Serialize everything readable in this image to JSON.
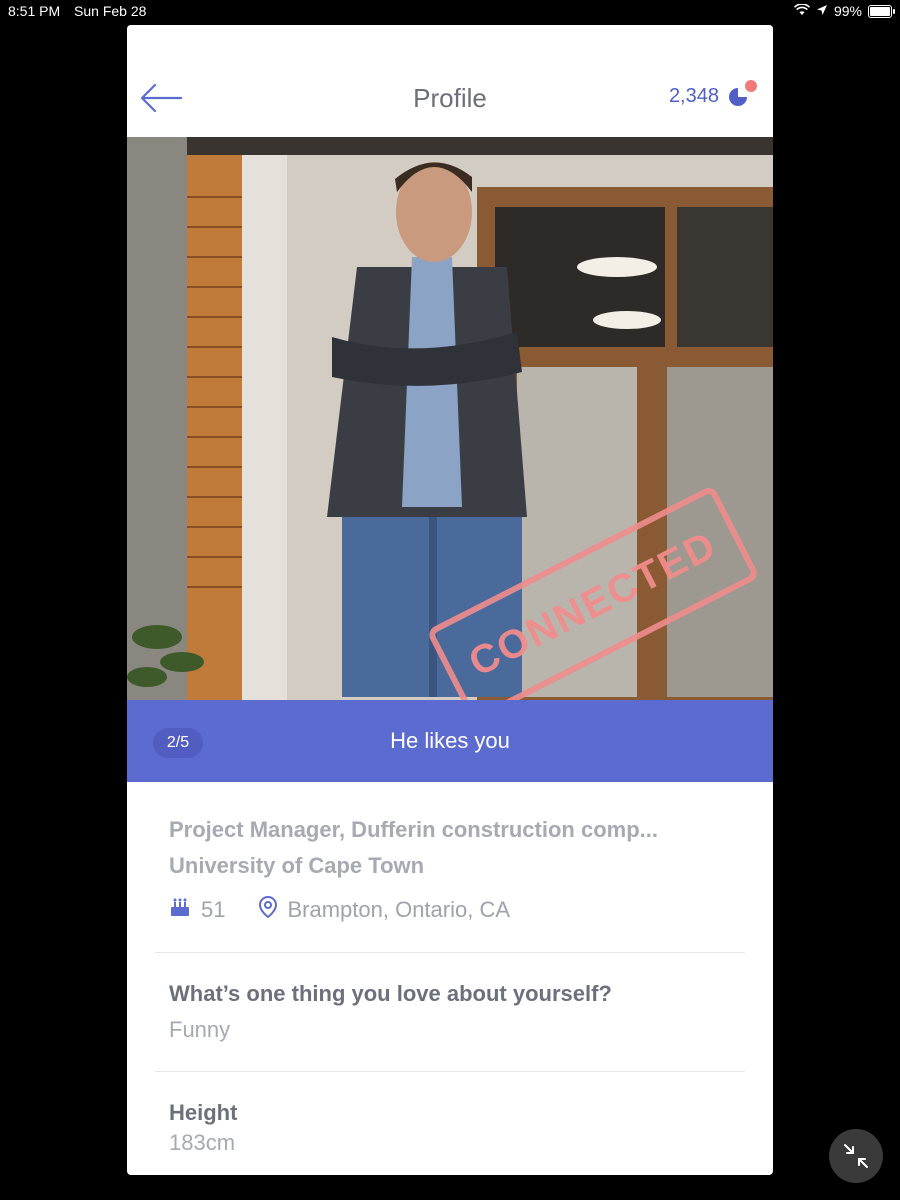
{
  "status_bar": {
    "time": "8:51 PM",
    "date": "Sun Feb 28",
    "battery": "99%"
  },
  "header": {
    "title": "Profile",
    "credits": "2,348"
  },
  "photo": {
    "counter": "2/5",
    "caption": "He likes you",
    "stamp": "CONNECTED"
  },
  "profile": {
    "job": "Project Manager, Dufferin construction comp...",
    "school": "University of Cape Town",
    "age": "51",
    "location": "Brampton, Ontario, CA"
  },
  "qa": {
    "question": "What’s one thing you love about yourself?",
    "answer": "Funny"
  },
  "height": {
    "label": "Height",
    "value": "183cm"
  },
  "colors": {
    "accent": "#5b6bd0",
    "badge": "#f07a7a"
  }
}
